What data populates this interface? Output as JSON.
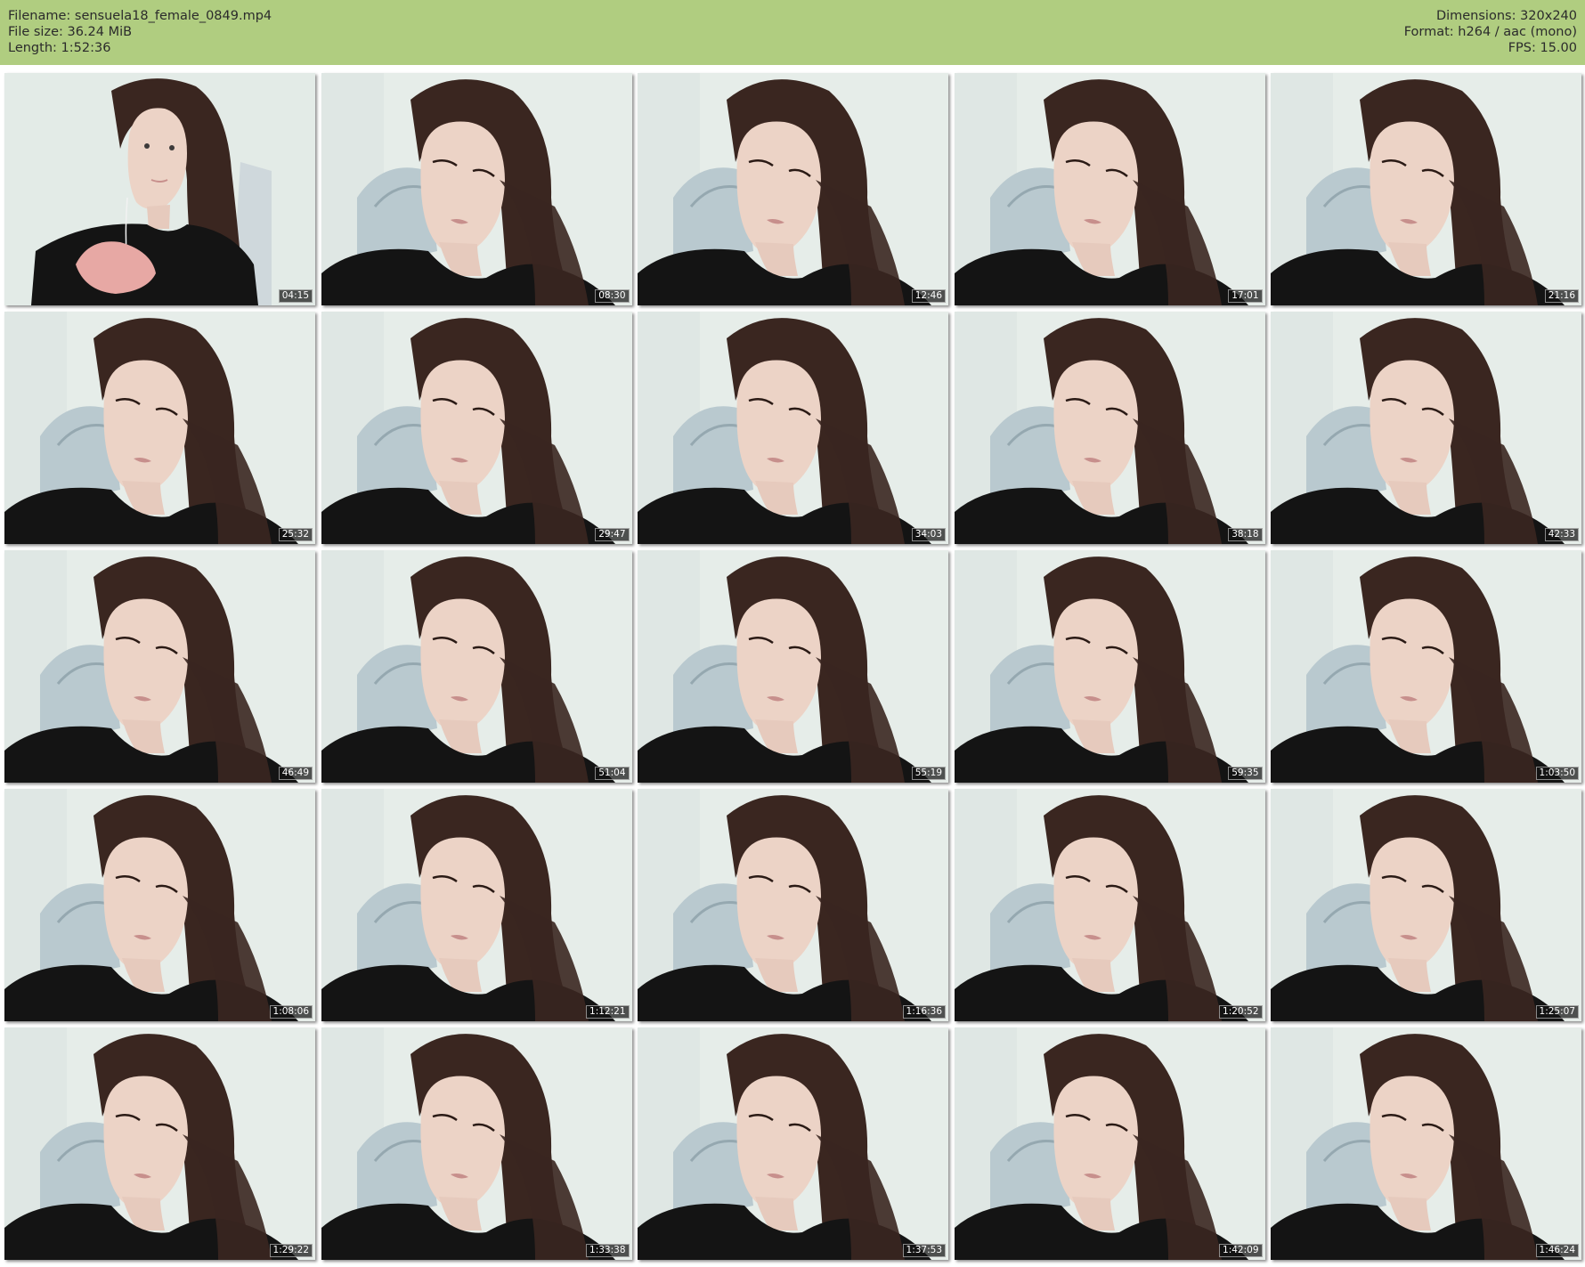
{
  "header": {
    "left": [
      {
        "label": "Filename:",
        "value": "sensuela18_female_0849.mp4"
      },
      {
        "label": "File size:",
        "value": "36.24 MiB"
      },
      {
        "label": "Length:",
        "value": "1:52:36"
      }
    ],
    "right": [
      {
        "label": "Dimensions:",
        "value": "320x240"
      },
      {
        "label": "Format:",
        "value": "h264 / aac (mono)"
      },
      {
        "label": "FPS:",
        "value": "15.00"
      }
    ]
  },
  "colors": {
    "header_bg": "#b0cd80",
    "background": "#ffffff",
    "thumb_bg": "#e7eeea",
    "hair": "#3a2620",
    "shirt": "#141414",
    "skin": "#ecd3c6"
  },
  "thumbnails": [
    {
      "time": "04:15",
      "scene": "wide"
    },
    {
      "time": "08:30",
      "scene": "closeup"
    },
    {
      "time": "12:46",
      "scene": "closeup"
    },
    {
      "time": "17:01",
      "scene": "closeup"
    },
    {
      "time": "21:16",
      "scene": "closeup"
    },
    {
      "time": "25:32",
      "scene": "closeup"
    },
    {
      "time": "29:47",
      "scene": "closeup"
    },
    {
      "time": "34:03",
      "scene": "closeup"
    },
    {
      "time": "38:18",
      "scene": "closeup"
    },
    {
      "time": "42:33",
      "scene": "closeup"
    },
    {
      "time": "46:49",
      "scene": "closeup"
    },
    {
      "time": "51:04",
      "scene": "closeup"
    },
    {
      "time": "55:19",
      "scene": "closeup"
    },
    {
      "time": "59:35",
      "scene": "closeup"
    },
    {
      "time": "1:03:50",
      "scene": "closeup"
    },
    {
      "time": "1:08:06",
      "scene": "closeup"
    },
    {
      "time": "1:12:21",
      "scene": "closeup"
    },
    {
      "time": "1:16:36",
      "scene": "closeup"
    },
    {
      "time": "1:20:52",
      "scene": "closeup"
    },
    {
      "time": "1:25:07",
      "scene": "closeup"
    },
    {
      "time": "1:29:22",
      "scene": "closeup"
    },
    {
      "time": "1:33:38",
      "scene": "closeup"
    },
    {
      "time": "1:37:53",
      "scene": "closeup"
    },
    {
      "time": "1:42:09",
      "scene": "closeup"
    },
    {
      "time": "1:46:24",
      "scene": "closeup"
    }
  ]
}
